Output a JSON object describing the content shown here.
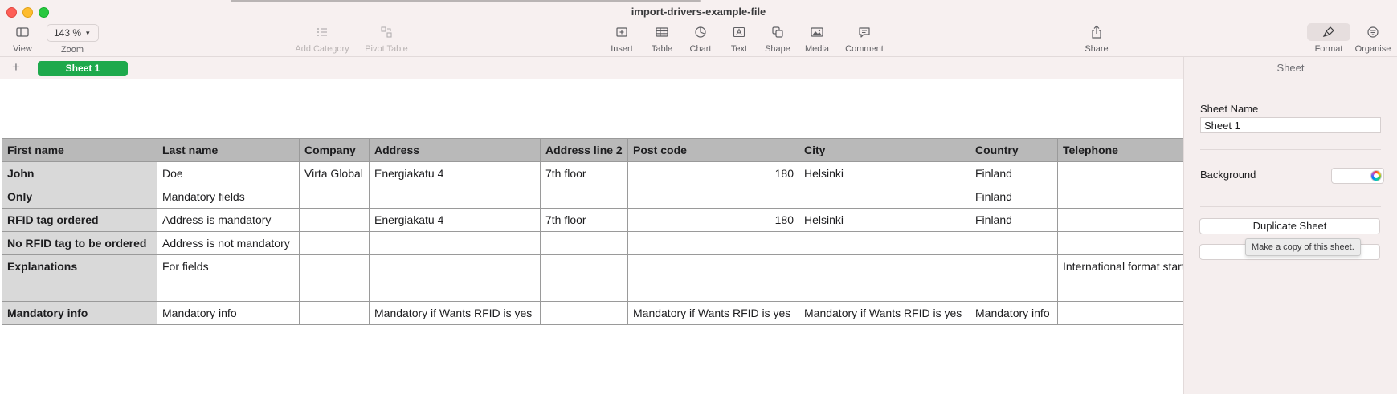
{
  "window": {
    "title": "import-drivers-example-file"
  },
  "toolbar": {
    "view_label": "View",
    "zoom_value": "143 %",
    "zoom_label": "Zoom",
    "add_category_label": "Add Category",
    "pivot_table_label": "Pivot Table",
    "insert_label": "Insert",
    "table_label": "Table",
    "chart_label": "Chart",
    "text_label": "Text",
    "shape_label": "Shape",
    "media_label": "Media",
    "comment_label": "Comment",
    "share_label": "Share",
    "format_label": "Format",
    "organise_label": "Organise"
  },
  "tabs": {
    "add_symbol": "+",
    "active_sheet": "Sheet 1"
  },
  "sidebar": {
    "title": "Sheet",
    "sheet_name_label": "Sheet Name",
    "sheet_name_value": "Sheet 1",
    "background_label": "Background",
    "duplicate_button": "Duplicate Sheet",
    "tooltip": "Make a copy of this sheet."
  },
  "table": {
    "headers": [
      "First name",
      "Last name",
      "Company",
      "Address",
      "Address line 2",
      "Post code",
      "City",
      "Country",
      "Telephone"
    ],
    "rows": [
      [
        "John",
        "Doe",
        "Virta Global",
        "Energiakatu 4",
        "7th floor",
        "180",
        "Helsinki",
        "Finland",
        ""
      ],
      [
        "Only",
        "Mandatory fields",
        "",
        "",
        "",
        "",
        "",
        "Finland",
        ""
      ],
      [
        "RFID tag ordered",
        "Address is mandatory",
        "",
        "Energiakatu 4",
        "7th floor",
        "180",
        "Helsinki",
        "Finland",
        ""
      ],
      [
        "No RFID tag to be ordered",
        "Address is not mandatory",
        "",
        "",
        "",
        "",
        "",
        "",
        ""
      ],
      [
        "Explanations",
        "For fields",
        "",
        "",
        "",
        "",
        "",
        "",
        "International format start"
      ],
      [
        "",
        "",
        "",
        "",
        "",
        "",
        "",
        "",
        ""
      ],
      [
        "Mandatory info",
        "Mandatory info",
        "",
        "Mandatory if Wants RFID is yes",
        "",
        "Mandatory if Wants RFID is yes",
        "Mandatory if Wants RFID is yes",
        "Mandatory info",
        ""
      ]
    ]
  },
  "colors": {
    "sheet_tab": "#1ea94c",
    "header_fill": "#b9b9b9",
    "row_header_fill": "#d9d9d9",
    "chrome": "#f7f0f0"
  }
}
